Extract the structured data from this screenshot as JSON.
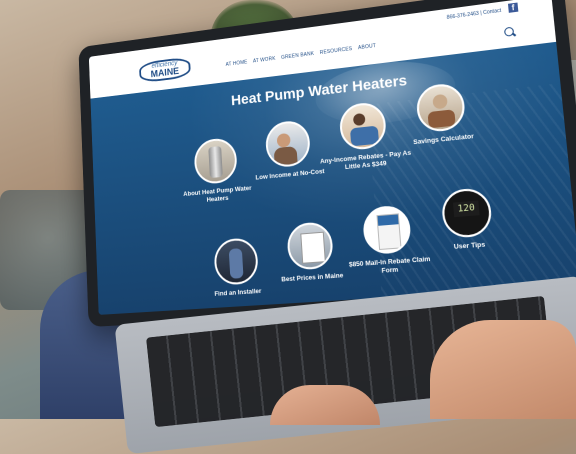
{
  "header": {
    "logo_line1": "efficiency",
    "logo_line2": "MAINE",
    "contact": "866-376-2463 | Contact",
    "nav": [
      "AT HOME",
      "AT WORK",
      "GREEN BANK",
      "RESOURCES",
      "ABOUT"
    ]
  },
  "hero": {
    "title": "Heat Pump Water Heaters"
  },
  "tiles": [
    {
      "label": "About Heat Pump Water Heaters",
      "icon": "water-heater"
    },
    {
      "label": "Low Income at No-Cost",
      "icon": "technician"
    },
    {
      "label": "Any-Income Rebates - Pay As Little As $349",
      "icon": "family"
    },
    {
      "label": "Savings Calculator",
      "icon": "person-reading"
    },
    {
      "label": "Find an Installer",
      "icon": "installer"
    },
    {
      "label": "Best Prices in Maine",
      "icon": "price-sheet"
    },
    {
      "label": "$850 Mail-In Rebate Claim Form",
      "icon": "rebate-form"
    },
    {
      "label": "User Tips",
      "icon": "thermostat-display"
    }
  ],
  "thermostat_display": "120",
  "colors": {
    "brand_blue": "#1f4c86",
    "hero_blue": "#1b4a7a",
    "facebook": "#3b5998"
  }
}
